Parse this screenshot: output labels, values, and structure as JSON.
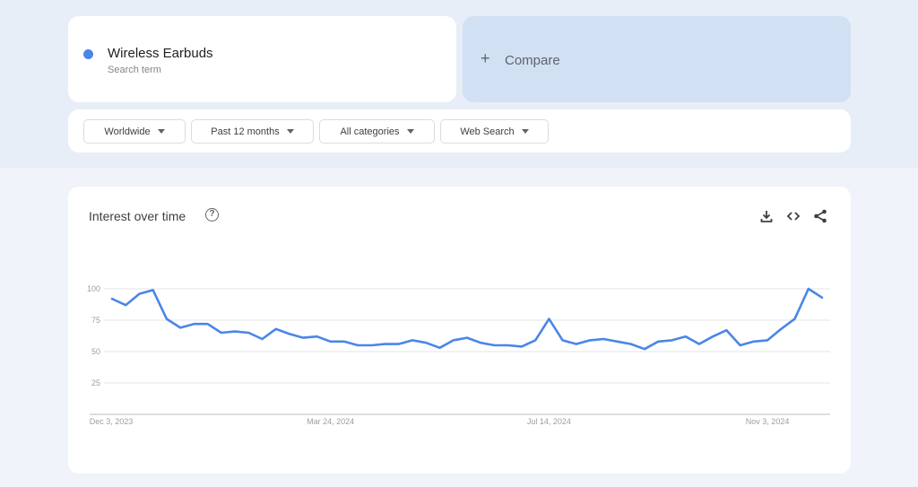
{
  "search_term": {
    "name": "Wireless Earbuds",
    "subtitle": "Search term",
    "color": "#4a86e8"
  },
  "compare": {
    "icon": "plus-icon",
    "label": "Compare"
  },
  "filters": [
    {
      "label": "Worldwide"
    },
    {
      "label": "Past 12 months"
    },
    {
      "label": "All categories"
    },
    {
      "label": "Web Search"
    }
  ],
  "chart_card": {
    "title": "Interest over time",
    "help_icon": "?",
    "actions": [
      "download-icon",
      "embed-code-icon",
      "share-icon"
    ]
  },
  "chart_data": {
    "type": "line",
    "title": "Interest over time",
    "xlabel": "",
    "ylabel": "",
    "ylim": [
      0,
      100
    ],
    "yticks": [
      25,
      50,
      75,
      100
    ],
    "x_tick_labels": [
      {
        "label": "Dec 3, 2023",
        "index": 0
      },
      {
        "label": "Mar 24, 2024",
        "index": 16
      },
      {
        "label": "Jul 14, 2024",
        "index": 32
      },
      {
        "label": "Nov 3, 2024",
        "index": 48
      }
    ],
    "grid": true,
    "legend": "none",
    "series": [
      {
        "name": "Wireless Earbuds",
        "color": "#4a86e8",
        "values": [
          92,
          87,
          96,
          99,
          76,
          69,
          72,
          72,
          65,
          66,
          65,
          60,
          68,
          64,
          61,
          62,
          58,
          58,
          55,
          55,
          56,
          56,
          59,
          57,
          53,
          59,
          61,
          57,
          55,
          55,
          54,
          59,
          76,
          59,
          56,
          59,
          60,
          58,
          56,
          52,
          58,
          59,
          62,
          56,
          62,
          67,
          55,
          58,
          59,
          68,
          76,
          100,
          93
        ]
      }
    ]
  }
}
